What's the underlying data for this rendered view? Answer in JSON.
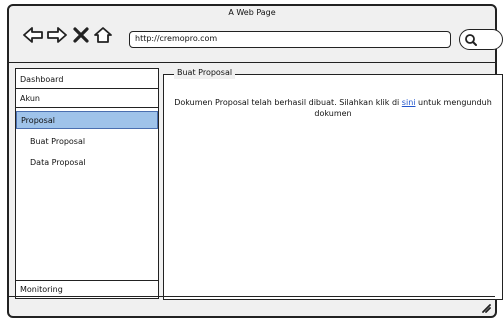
{
  "window": {
    "title": "A Web Page"
  },
  "toolbar": {
    "url": "http://cremopro.com"
  },
  "sidebar": {
    "items": [
      {
        "label": "Dashboard"
      },
      {
        "label": "Akun"
      },
      {
        "label": "Proposal"
      },
      {
        "label": "Buat Proposal"
      },
      {
        "label": "Data Proposal"
      },
      {
        "label": "Monitoring"
      }
    ]
  },
  "main": {
    "legend": "Buat Proposal",
    "message_before": "Dokumen Proposal telah berhasil dibuat. Silahkan klik di ",
    "link_text": "sini",
    "message_after": " untuk mengunduh dokumen"
  },
  "colors": {
    "active_item": "#9fc3ea",
    "link": "#2255cc"
  }
}
